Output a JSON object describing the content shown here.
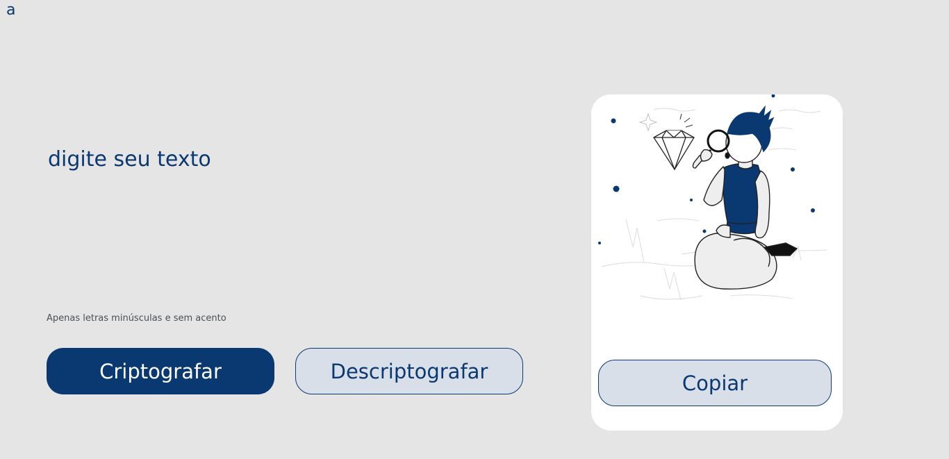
{
  "header": {
    "logo_text": "a"
  },
  "editor": {
    "placeholder": "digite seu texto"
  },
  "hint": {
    "text": "Apenas letras minúsculas e sem acento"
  },
  "actions": {
    "encrypt_label": "Criptografar",
    "decrypt_label": "Descriptografar"
  },
  "output_panel": {
    "illustration": "person-with-magnifier-and-diamond-illustration",
    "copy_label": "Copiar"
  },
  "colors": {
    "accent": "#0a3871",
    "background": "#e5e5e5",
    "secondary_button": "#d8dfe8",
    "panel": "#ffffff"
  }
}
